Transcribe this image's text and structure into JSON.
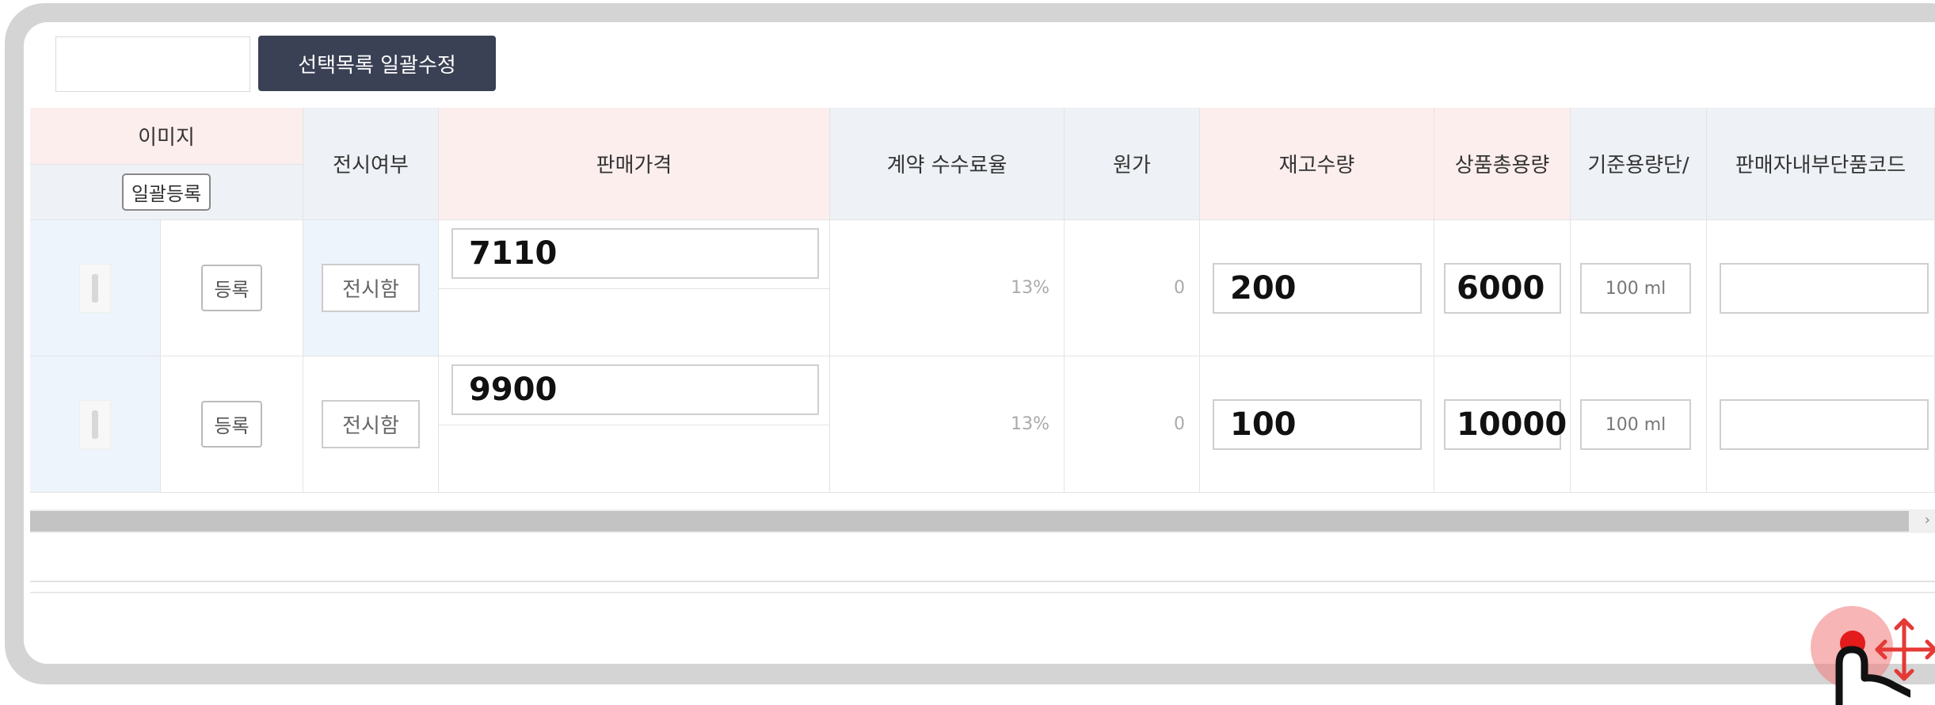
{
  "toolbar": {
    "input_value": "",
    "bulk_edit_label": "선택목록 일괄수정"
  },
  "columns": {
    "image": "이미지",
    "image_bulk_button": "일괄등록",
    "display": "전시여부",
    "price": "판매가격",
    "commission": "계약 수수료율",
    "cost": "원가",
    "stock": "재고수량",
    "total_volume": "상품총용량",
    "unit_volume": "기준용량단/",
    "seller_code": "판매자내부단품코드"
  },
  "rows": [
    {
      "register_label": "등록",
      "display_value": "전시함",
      "price": "7110",
      "commission": "13%",
      "cost": "0",
      "stock": "200",
      "total_volume": "6000",
      "unit_volume": "100 ml",
      "seller_code": ""
    },
    {
      "register_label": "등록",
      "display_value": "전시함",
      "price": "9900",
      "commission": "13%",
      "cost": "0",
      "stock": "100",
      "total_volume": "10000",
      "unit_volume": "100 ml",
      "seller_code": ""
    }
  ],
  "scrollbar": {
    "right_arrow": "›"
  },
  "icons": {
    "hand": "pointer-hand-icon",
    "move": "move-arrows-icon"
  },
  "colors": {
    "button_dark": "#3a4154",
    "header_pink": "#fdeeee",
    "header_gray": "#eef1f5",
    "touch_red": "#e31b1b"
  }
}
